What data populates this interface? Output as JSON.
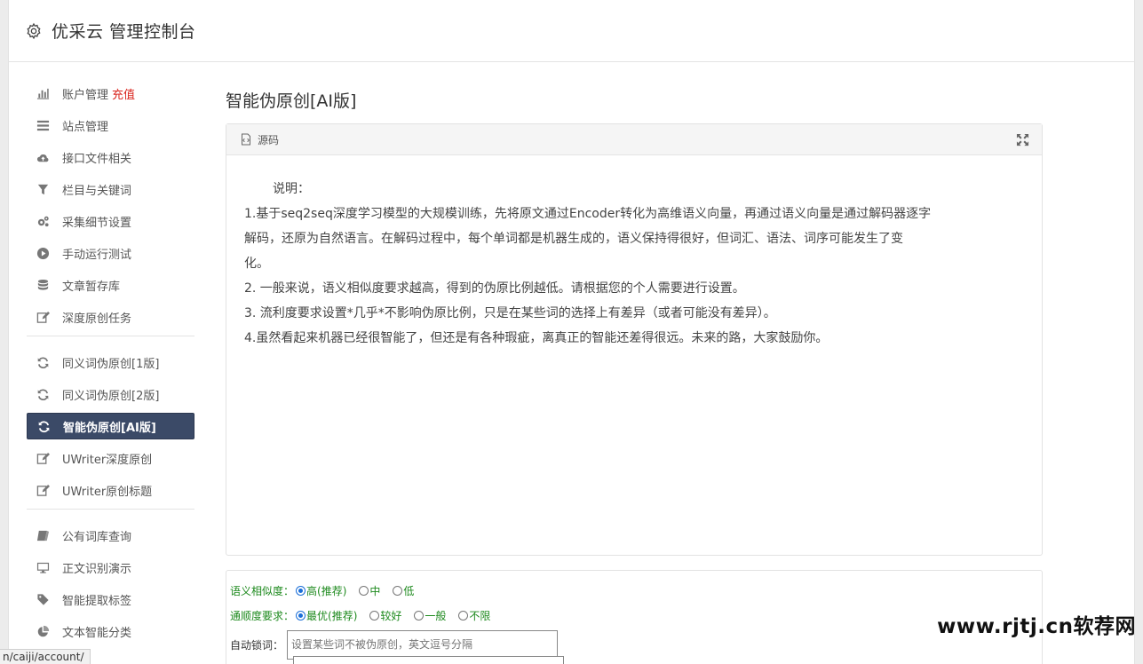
{
  "header": {
    "title": "优采云 管理控制台",
    "icon": "gear-icon"
  },
  "sidebar": {
    "group1": [
      {
        "label": "账户管理",
        "extra": "充值",
        "icon": "bar-chart-icon"
      },
      {
        "label": "站点管理",
        "icon": "list-icon"
      },
      {
        "label": "接口文件相关",
        "icon": "cloud-upload-icon"
      },
      {
        "label": "栏目与关键词",
        "icon": "filter-icon"
      },
      {
        "label": "采集细节设置",
        "icon": "gears-icon"
      },
      {
        "label": "手动运行测试",
        "icon": "play-circle-icon"
      },
      {
        "label": "文章暂存库",
        "icon": "database-icon"
      },
      {
        "label": "深度原创任务",
        "icon": "edit-icon"
      }
    ],
    "group2": [
      {
        "label": "同义词伪原创[1版]",
        "icon": "refresh-icon"
      },
      {
        "label": "同义词伪原创[2版]",
        "icon": "refresh-icon"
      },
      {
        "label": "智能伪原创[AI版]",
        "icon": "refresh-icon",
        "active": true
      },
      {
        "label": "UWriter深度原创",
        "icon": "edit-icon"
      },
      {
        "label": "UWriter原创标题",
        "icon": "edit-icon"
      }
    ],
    "group3": [
      {
        "label": "公有词库查询",
        "icon": "book-icon"
      },
      {
        "label": "正文识别演示",
        "icon": "monitor-icon"
      },
      {
        "label": "智能提取标签",
        "icon": "tag-icon"
      },
      {
        "label": "文本智能分类",
        "icon": "pie-chart-icon"
      }
    ]
  },
  "main": {
    "title": "智能伪原创[AI版]",
    "panel": {
      "header": "源码",
      "intro": "说明：",
      "lines": [
        "1.基于seq2seq深度学习模型的大规模训练，先将原文通过Encoder转化为高维语义向量，再通过语义向量是通过解码器逐字",
        "解码，还原为自然语言。在解码过程中，每个单词都是机器生成的，语义保持得很好，但词汇、语法、词序可能发生了变",
        "化。",
        "2. 一般来说，语义相似度要求越高，得到的伪原比例越低。请根据您的个人需要进行设置。",
        "3. 流利度要求设置*几乎*不影响伪原比例，只是在某些词的选择上有差异（或者可能没有差异）。",
        "4.虽然看起来机器已经很智能了，但还是有各种瑕疵，离真正的智能还差得很远。未来的路，大家鼓励你。"
      ]
    },
    "settings": {
      "similarity": {
        "label": "语义相似度：",
        "options": [
          "高(推荐)",
          "中",
          "低"
        ],
        "selected": 0
      },
      "fluency": {
        "label": "通顺度要求：",
        "options": [
          "最优(推荐)",
          "较好",
          "一般",
          "不限"
        ],
        "selected": 0
      },
      "lock": {
        "label": "自动锁词：",
        "placeholder": "设置某些词不被伪原创，英文逗号分隔"
      }
    }
  },
  "status": {
    "url": "n/caiji/account/"
  },
  "watermark": "www.rjtj.cn软荐网",
  "colors": {
    "active_bg": "#3b4a67",
    "option_text": "#1e8a1e",
    "highlight": "#d9241d"
  }
}
